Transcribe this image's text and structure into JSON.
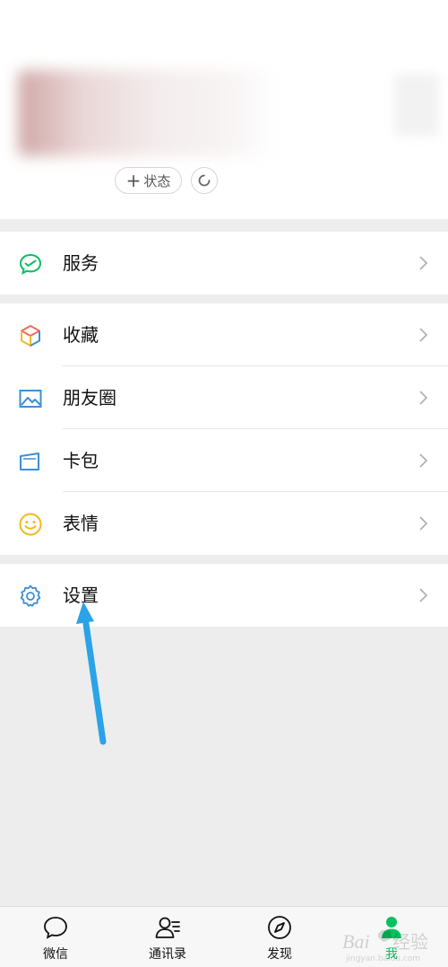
{
  "profile": {
    "status_button": {
      "plus": "+",
      "label": "状态"
    }
  },
  "menu": [
    {
      "label": "服务",
      "icon": "wechat-pay-service-icon",
      "color": "#07c160"
    },
    {
      "label": "收藏",
      "icon": "favorites-cube-icon",
      "color": "#f06b5b"
    },
    {
      "label": "朋友圈",
      "icon": "moments-image-icon",
      "color": "#3b8fd6"
    },
    {
      "label": "卡包",
      "icon": "card-wallet-icon",
      "color": "#3b8fd6"
    },
    {
      "label": "表情",
      "icon": "emoji-smile-icon",
      "color": "#f5b920"
    },
    {
      "label": "设置",
      "icon": "settings-gear-icon",
      "color": "#3b8fd6"
    }
  ],
  "tabbar": [
    {
      "label": "微信",
      "icon": "chat-bubble-icon"
    },
    {
      "label": "通讯录",
      "icon": "contacts-icon"
    },
    {
      "label": "发现",
      "icon": "compass-icon"
    },
    {
      "label": "我",
      "icon": "me-person-icon",
      "active": true
    }
  ],
  "watermark": {
    "text": "Baidu经验",
    "sub": "jingyan.baidu.com"
  },
  "colors": {
    "accent": "#07c160",
    "background": "#ededed",
    "arrow": "#2aa3e8"
  }
}
